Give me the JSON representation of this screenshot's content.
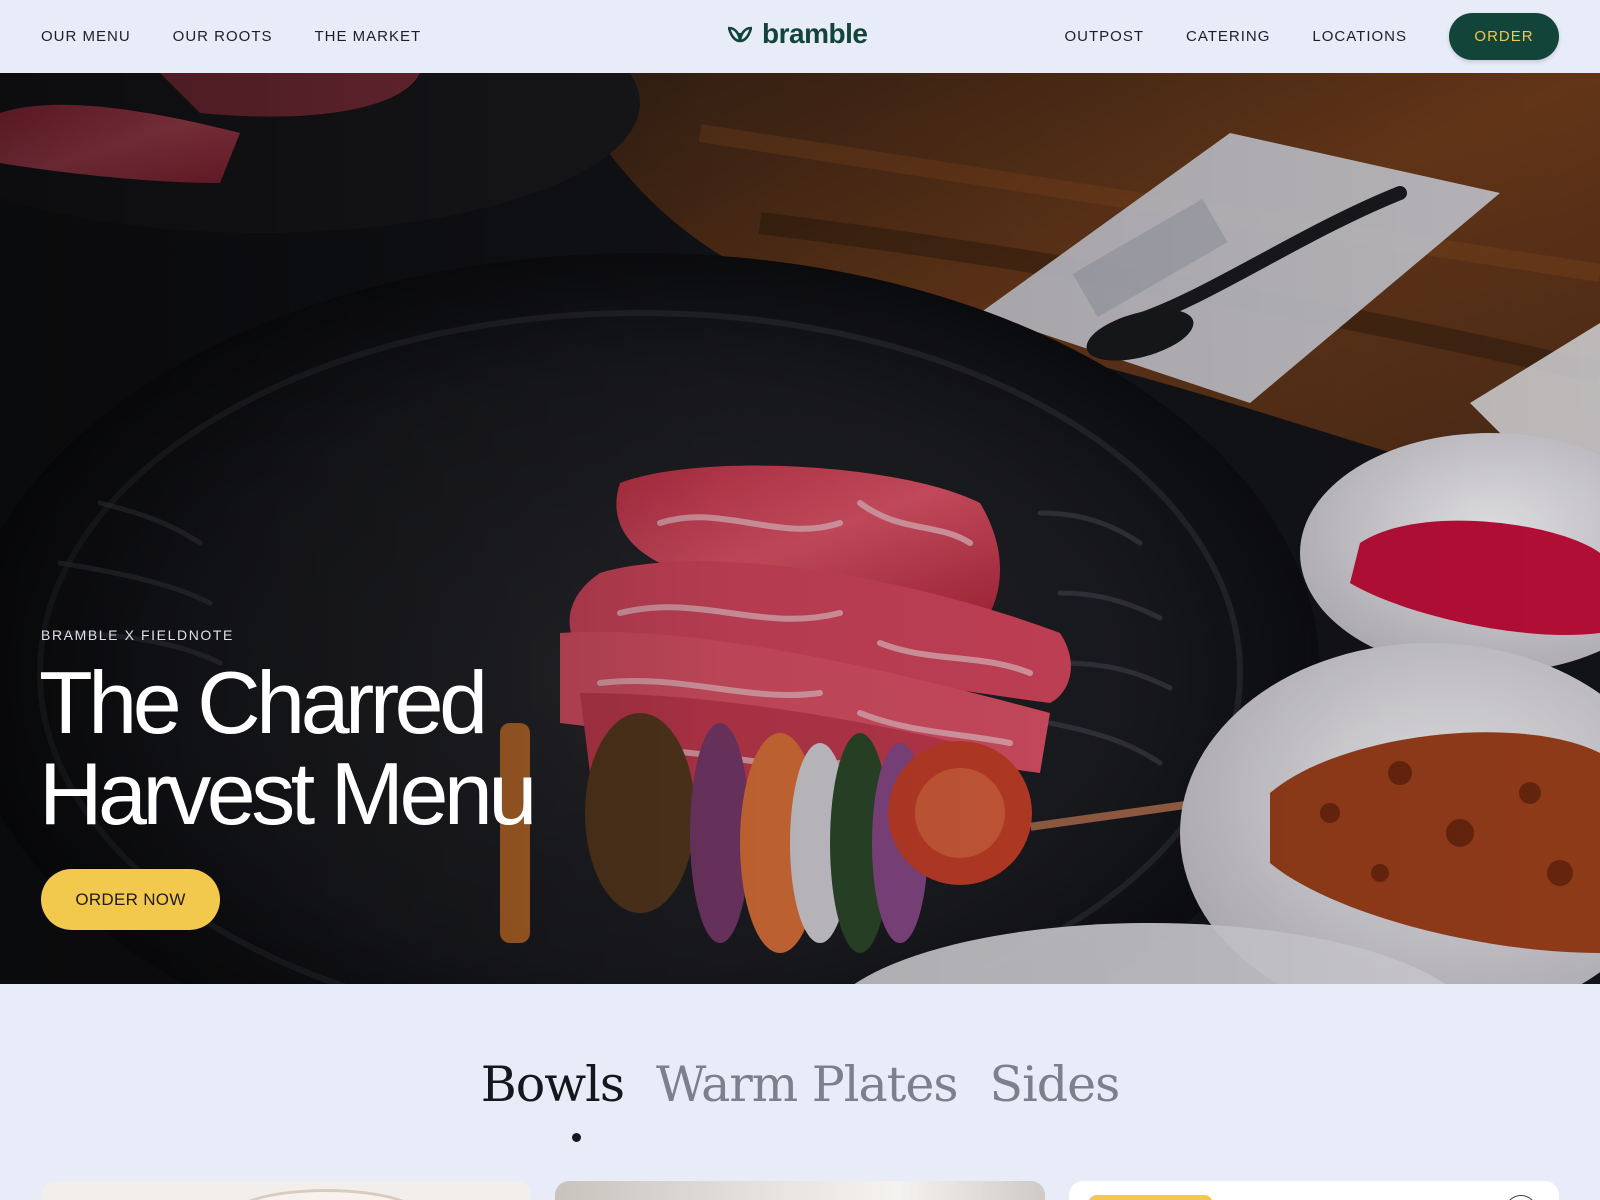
{
  "header": {
    "nav_left": [
      "OUR MENU",
      "OUR ROOTS",
      "THE MARKET"
    ],
    "logo_text": "bramble",
    "nav_right": [
      "OUTPOST",
      "CATERING",
      "LOCATIONS"
    ],
    "order_label": "ORDER"
  },
  "hero": {
    "eyebrow": "BRAMBLE X FIELDNOTE",
    "title_line1": "The Charred",
    "title_line2": "Harvest Menu",
    "cta_label": "ORDER NOW"
  },
  "menu_tabs": {
    "items": [
      "Bowls",
      "Warm Plates",
      "Sides"
    ],
    "active": "Bowls"
  },
  "colors": {
    "background": "#e8ebf8",
    "brand_green": "#12443a",
    "accent_yellow": "#f2c94c"
  }
}
